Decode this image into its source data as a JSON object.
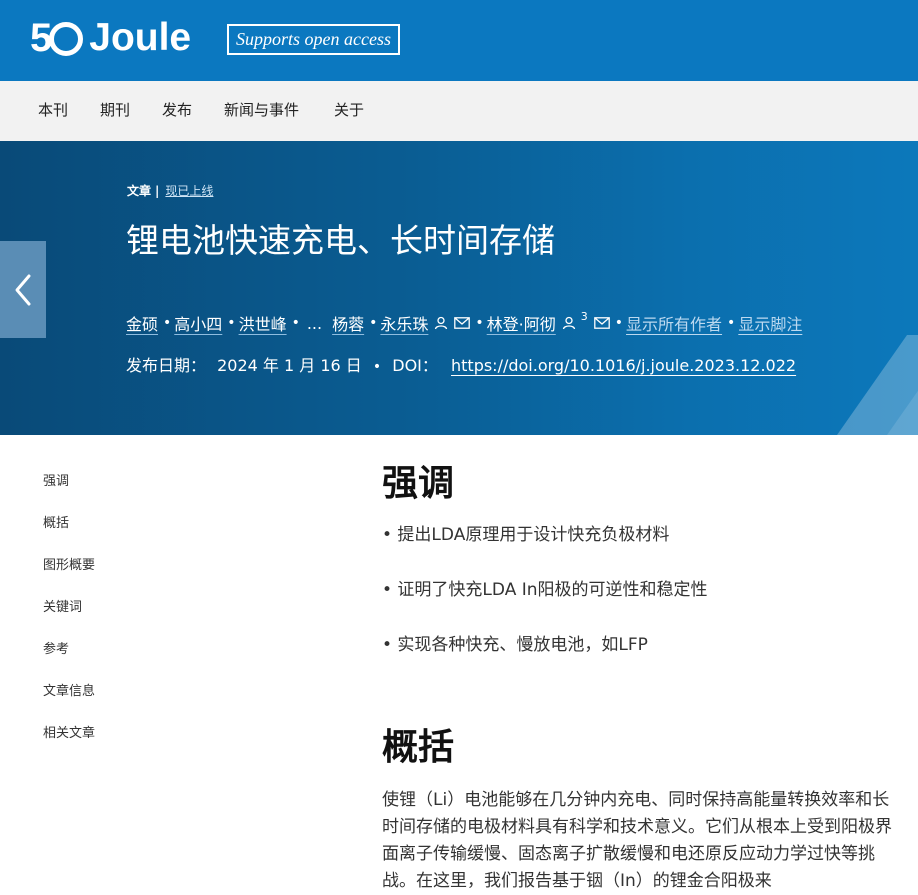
{
  "brand": {
    "logo_number": "5",
    "logo_name": "Joule",
    "badge": "Supports open access"
  },
  "nav": {
    "items": [
      "本刊",
      "期刊",
      "发布",
      "新闻与事件",
      "关于"
    ]
  },
  "breadcrumb": {
    "type": "文章",
    "separator": "|",
    "status": "现已上线"
  },
  "article": {
    "title": "锂电池快速充电、长时间存储",
    "authors": [
      "金硕",
      "高小四",
      "洪世峰",
      "杨蓉",
      "永乐珠",
      "林登·阿彻"
    ],
    "ellipsis": "...",
    "sup": "3",
    "show_all_authors": "显示所有作者",
    "show_footnotes": "显示脚注",
    "pub_label": "发布日期：",
    "pub_date": "2024 年 1 月 16 日",
    "doi_label": "DOI：",
    "doi": "https://doi.org/10.1016/j.joule.2023.12.022"
  },
  "toc": {
    "items": [
      "强调",
      "概括",
      "图形概要",
      "关键词",
      "参考",
      "文章信息",
      "相关文章"
    ]
  },
  "highlights": {
    "heading": "强调",
    "items": [
      "• 提出LDA原理用于设计快充负极材料",
      "• 证明了快充LDA In阳极的可逆性和稳定性",
      "• 实现各种快充、慢放电池，如LFP"
    ]
  },
  "summary": {
    "heading": "概括",
    "text": "使锂（Li）电池能够在几分钟内充电、同时保持高能量转换效率和长时间存储的电极材料具有科学和技术意义。它们从根本上受到阳极界面离子传输缓慢、固态离子扩散缓慢和电还原反应动力学过快等挑战。在这里，我们报告基于铟（In）的锂金合阳极来"
  },
  "colors": {
    "brand_blue": "#0b78c0",
    "nav_bg": "#f2f2f2",
    "hero_dark": "#094a78",
    "prev_tab": "#5a8db5"
  }
}
